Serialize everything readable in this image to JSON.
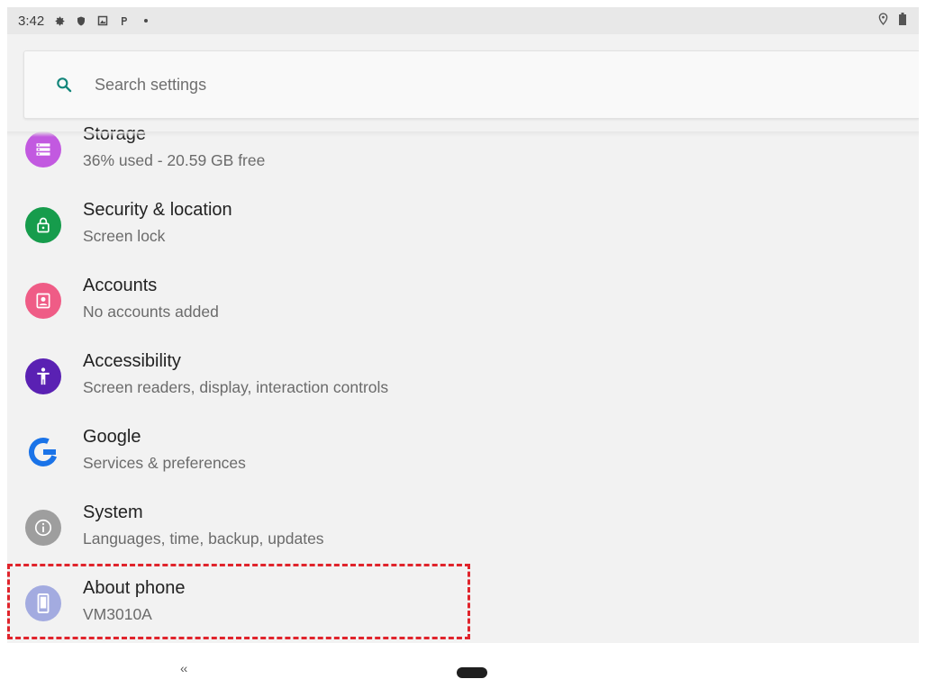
{
  "status_bar": {
    "time": "3:42",
    "left_icons": [
      "settings-gear-icon",
      "shield-icon",
      "screenshot-icon",
      "parking-icon",
      "dot-icon"
    ],
    "right_icons": [
      "location-icon",
      "battery-icon"
    ]
  },
  "search": {
    "placeholder": "Search settings"
  },
  "items": [
    {
      "title": "Storage",
      "subtitle": "36% used - 20.59 GB free",
      "icon": "storage-icon",
      "color": "#c259e0"
    },
    {
      "title": "Security & location",
      "subtitle": "Screen lock",
      "icon": "lock-icon",
      "color": "#169c4c"
    },
    {
      "title": "Accounts",
      "subtitle": "No accounts added",
      "icon": "account-icon",
      "color": "#ef5c86"
    },
    {
      "title": "Accessibility",
      "subtitle": "Screen readers, display, interaction controls",
      "icon": "accessibility-icon",
      "color": "#5a21b3"
    },
    {
      "title": "Google",
      "subtitle": "Services & preferences",
      "icon": "google-icon",
      "color": "#ffffff"
    },
    {
      "title": "System",
      "subtitle": "Languages, time, backup, updates",
      "icon": "info-icon",
      "color": "#9e9e9e"
    },
    {
      "title": "About phone",
      "subtitle": "VM3010A",
      "icon": "phone-icon",
      "color": "#a3abe0"
    }
  ],
  "nav": {
    "back_glyph": "‹‹"
  }
}
